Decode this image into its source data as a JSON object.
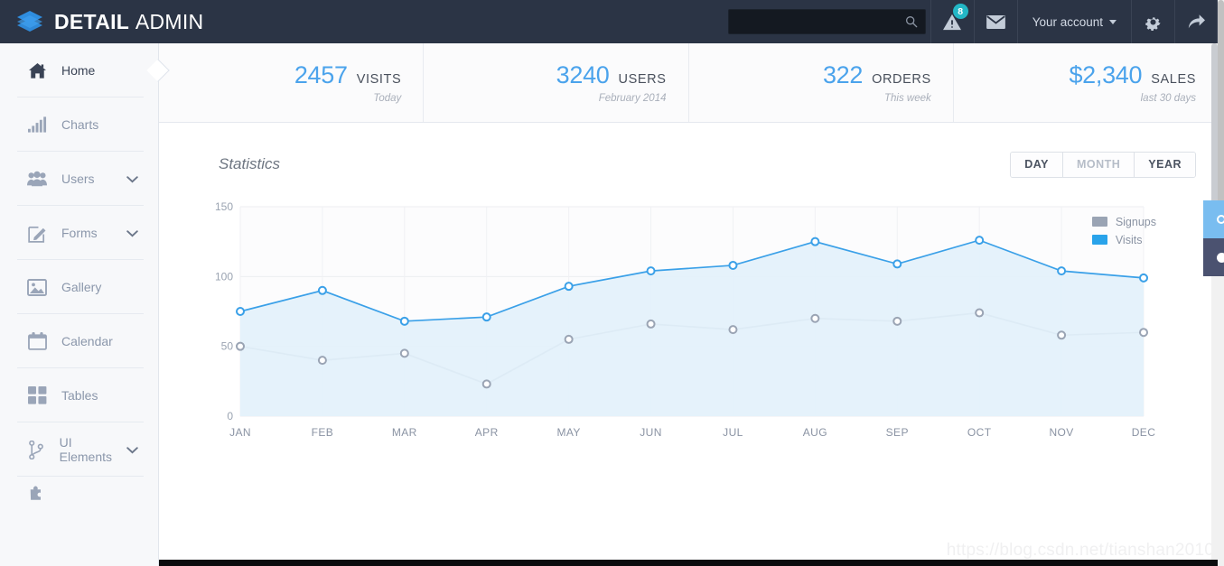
{
  "brand": {
    "bold": "DETAIL",
    "light": "ADMIN",
    "logo_icon": "layers-icon"
  },
  "topbar": {
    "search": {
      "value": "",
      "placeholder": "",
      "icon": "search-icon"
    },
    "alerts": {
      "icon": "warning-triangle-icon",
      "badge": "8"
    },
    "messages": {
      "icon": "envelope-icon"
    },
    "account": {
      "label": "Your account",
      "caret": "chevron-down-icon"
    },
    "settings": {
      "icon": "gear-icon"
    },
    "logout": {
      "icon": "share-arrow-icon"
    }
  },
  "sidebar": {
    "items": [
      {
        "label": "Home",
        "icon": "home-icon",
        "active": true,
        "chevron": ""
      },
      {
        "label": "Charts",
        "icon": "bar-chart-icon",
        "active": false,
        "chevron": ""
      },
      {
        "label": "Users",
        "icon": "users-icon",
        "active": false,
        "chevron": "chevron-down-icon"
      },
      {
        "label": "Forms",
        "icon": "edit-pencil-icon",
        "active": false,
        "chevron": "chevron-down-icon"
      },
      {
        "label": "Gallery",
        "icon": "image-icon",
        "active": false,
        "chevron": ""
      },
      {
        "label": "Calendar",
        "icon": "calendar-icon",
        "active": false,
        "chevron": ""
      },
      {
        "label": "Tables",
        "icon": "grid-squares-icon",
        "active": false,
        "chevron": ""
      },
      {
        "label": "UI Elements",
        "icon": "sitemap-icon",
        "active": false,
        "chevron": "chevron-down-icon"
      }
    ]
  },
  "stats": [
    {
      "value": "2457",
      "label": "VISITS",
      "sub": "Today"
    },
    {
      "value": "3240",
      "label": "USERS",
      "sub": "February 2014"
    },
    {
      "value": "322",
      "label": "ORDERS",
      "sub": "This week"
    },
    {
      "value": "$2,340",
      "label": "SALES",
      "sub": "last 30 days"
    }
  ],
  "panel": {
    "title": "Statistics",
    "range_buttons": [
      {
        "label": "DAY",
        "state": "normal"
      },
      {
        "label": "MONTH",
        "state": "muted"
      },
      {
        "label": "YEAR",
        "state": "normal"
      }
    ],
    "side_tabs": [
      {
        "icon": "circle-outline-icon",
        "color": "#79bdf0"
      },
      {
        "icon": "circle-filled-icon",
        "color": "#4b5270"
      }
    ]
  },
  "chart_data": {
    "type": "area",
    "title": "Statistics",
    "xlabel": "",
    "ylabel": "",
    "categories": [
      "JAN",
      "FEB",
      "MAR",
      "APR",
      "MAY",
      "JUN",
      "JUL",
      "AUG",
      "SEP",
      "OCT",
      "NOV",
      "DEC"
    ],
    "yticks": [
      "0",
      "50",
      "100",
      "150"
    ],
    "ylim": [
      0,
      150
    ],
    "grid": true,
    "legend_position": "top-right",
    "series": [
      {
        "name": "Signups",
        "color": "#9aa4b4",
        "fill": "#f3f4f6",
        "values": [
          50,
          40,
          45,
          23,
          55,
          66,
          62,
          70,
          68,
          74,
          58,
          60
        ]
      },
      {
        "name": "Visits",
        "color": "#3aa0e8",
        "fill": "#e3f1fb",
        "values": [
          75,
          90,
          68,
          71,
          93,
          104,
          108,
          125,
          109,
          126,
          104,
          99
        ]
      }
    ]
  },
  "watermark": {
    "text": "https://blog.csdn.net/tianshan2010"
  }
}
